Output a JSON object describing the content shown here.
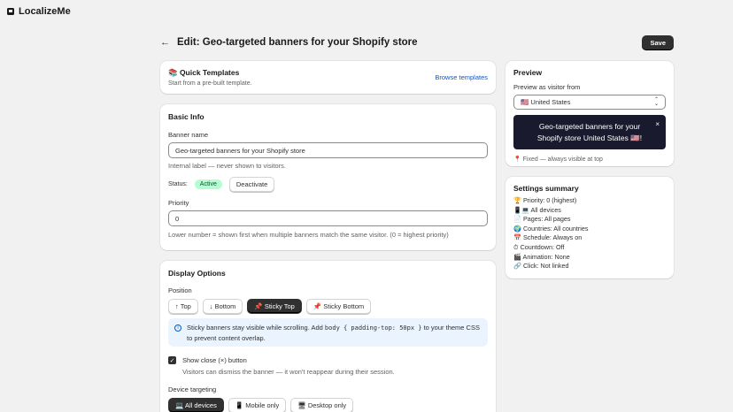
{
  "app": {
    "title": "LocalizeMe"
  },
  "header": {
    "back": "←",
    "title": "Edit: Geo-targeted banners for your Shopify store",
    "save_label": "Save"
  },
  "quick_templates": {
    "title": "📚 Quick Templates",
    "subtitle": "Start from a pre-built template.",
    "browse_label": "Browse templates"
  },
  "basic_info": {
    "title": "Basic Info",
    "banner_name_label": "Banner name",
    "banner_name_value": "Geo-targeted banners for your Shopify store",
    "banner_name_help": "Internal label — never shown to visitors.",
    "status_label": "Status:",
    "status_value": "Active",
    "deactivate_label": "Deactivate",
    "priority_label": "Priority",
    "priority_value": "0",
    "priority_help": "Lower number = shown first when multiple banners match the same visitor. (0 = highest priority)"
  },
  "display_options": {
    "title": "Display Options",
    "position_label": "Position",
    "positions": [
      {
        "label": "↑ Top",
        "active": false
      },
      {
        "label": "↓ Bottom",
        "active": false
      },
      {
        "label": "📌 Sticky Top",
        "active": true
      },
      {
        "label": "📌 Sticky Bottom",
        "active": false
      }
    ],
    "info_prefix": "Sticky banners stay visible while scrolling. Add",
    "info_code": "body { padding-top: 50px }",
    "info_suffix": "to your theme CSS to prevent content overlap.",
    "show_close_label": "Show close (×) button",
    "show_close_checked": true,
    "show_close_help": "Visitors can dismiss the banner — it won't reappear during their session.",
    "device_label": "Device targeting",
    "devices": [
      {
        "label": "💻 All devices",
        "active": true
      },
      {
        "label": "📱 Mobile only",
        "active": false
      },
      {
        "label": "🖥 Desktop only",
        "active": false
      }
    ]
  },
  "preview": {
    "title": "Preview",
    "visitor_label": "Preview as visitor from",
    "visitor_value": "🇺🇸 United States",
    "banner_text": "Geo-targeted banners for your Shopify store United States 🇺🇸!",
    "close": "×",
    "note": "📍 Fixed — always visible at top"
  },
  "summary": {
    "title": "Settings summary",
    "lines": [
      "🏆 Priority: 0 (highest)",
      "📱💻 All devices",
      "📄 Pages: All pages",
      "🌍 Countries: All countries",
      "📅 Schedule: Always on",
      "⏱ Countdown: Off",
      "🎬 Animation: None",
      "🔗 Click: Not linked"
    ]
  },
  "colors": {
    "accent": "#303030",
    "link": "#005bd3",
    "badge_bg": "#b4fed2",
    "info_bg": "#eaf4ff",
    "banner_bg": "#1a1a2e"
  }
}
